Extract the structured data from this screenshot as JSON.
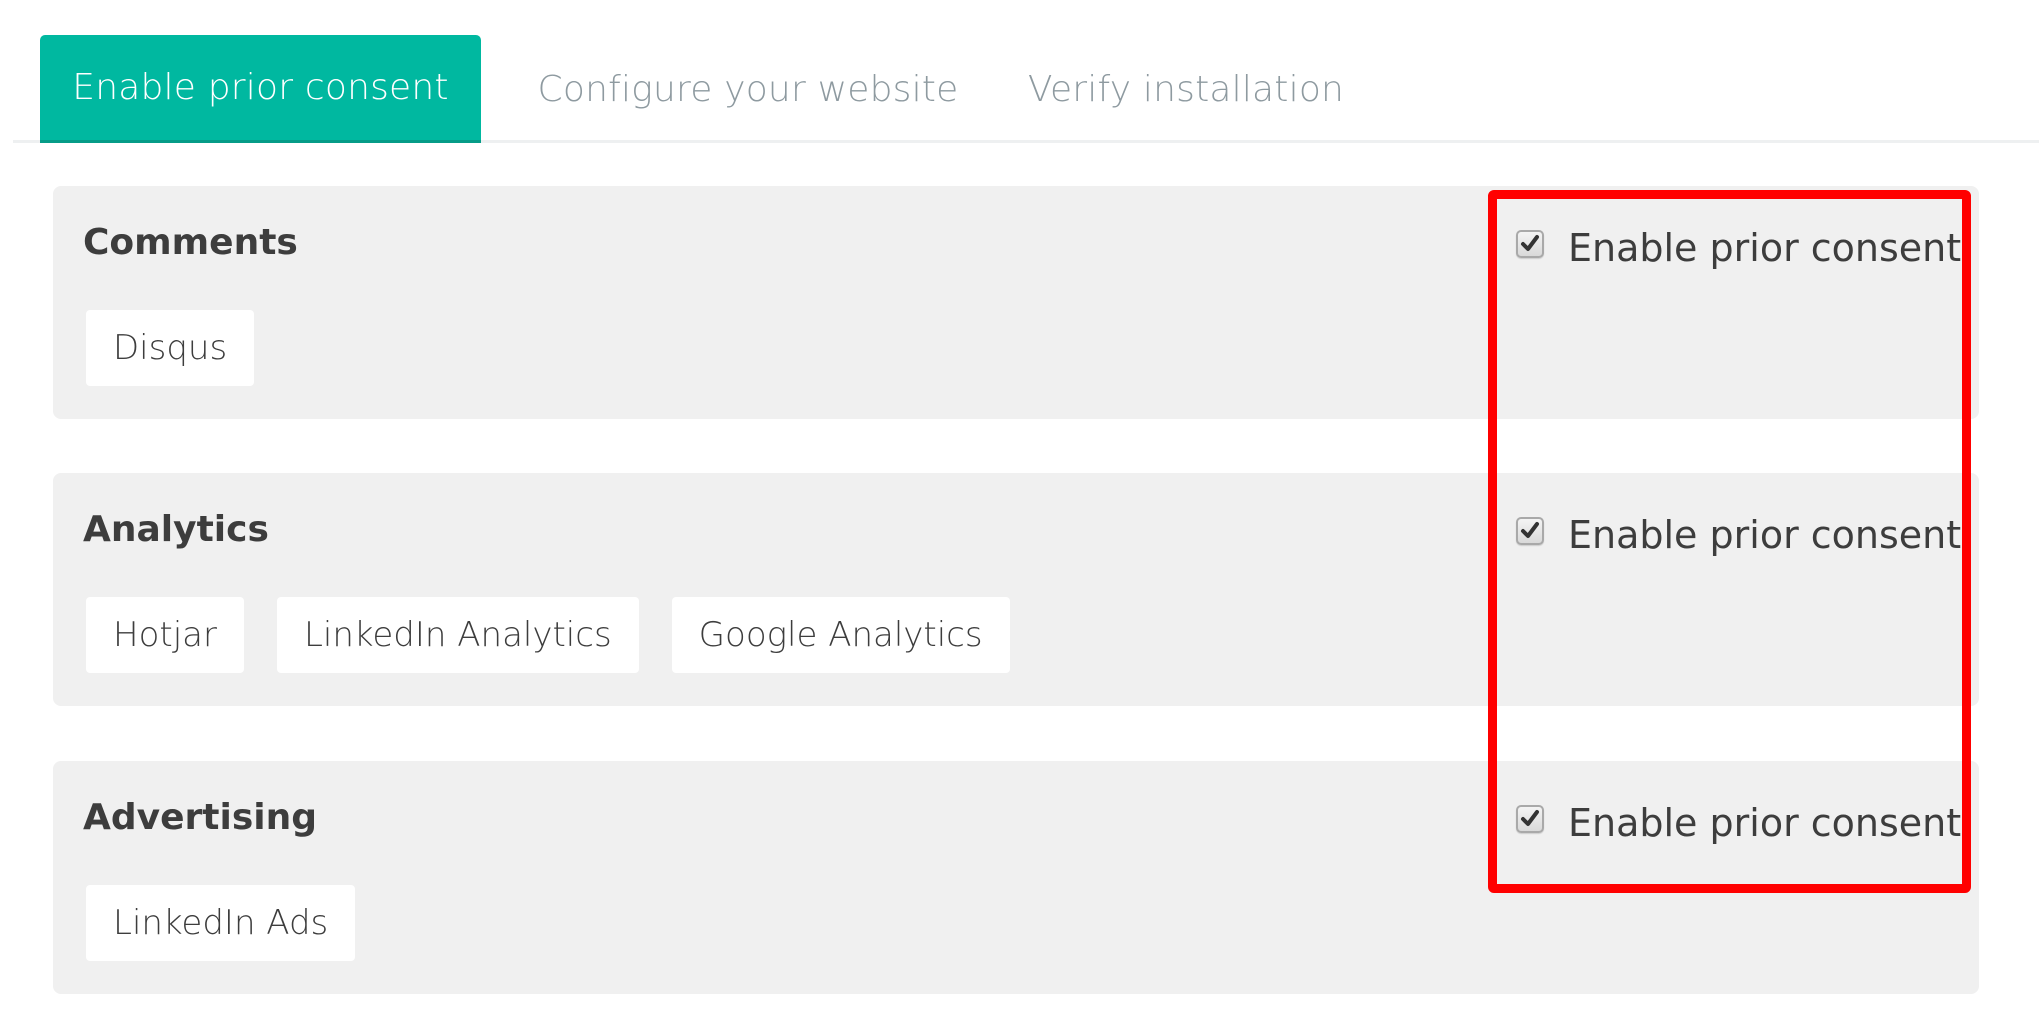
{
  "tabs": [
    {
      "label": "Enable prior consent",
      "active": true
    },
    {
      "label": "Configure your website",
      "active": false
    },
    {
      "label": "Verify installation",
      "active": false
    }
  ],
  "categories": [
    {
      "title": "Comments",
      "services": [
        "Disqus"
      ],
      "consent_label": "Enable prior consent",
      "checked": true
    },
    {
      "title": "Analytics",
      "services": [
        "Hotjar",
        "LinkedIn Analytics",
        "Google Analytics"
      ],
      "consent_label": "Enable prior consent",
      "checked": true
    },
    {
      "title": "Advertising",
      "services": [
        "LinkedIn Ads"
      ],
      "consent_label": "Enable prior consent",
      "checked": true
    }
  ],
  "colors": {
    "accent": "#00b8a0",
    "highlight": "#ff0000",
    "card_bg": "#f0f0f0",
    "text": "#3d3d3d",
    "tab_inactive": "#8e9aa0"
  }
}
